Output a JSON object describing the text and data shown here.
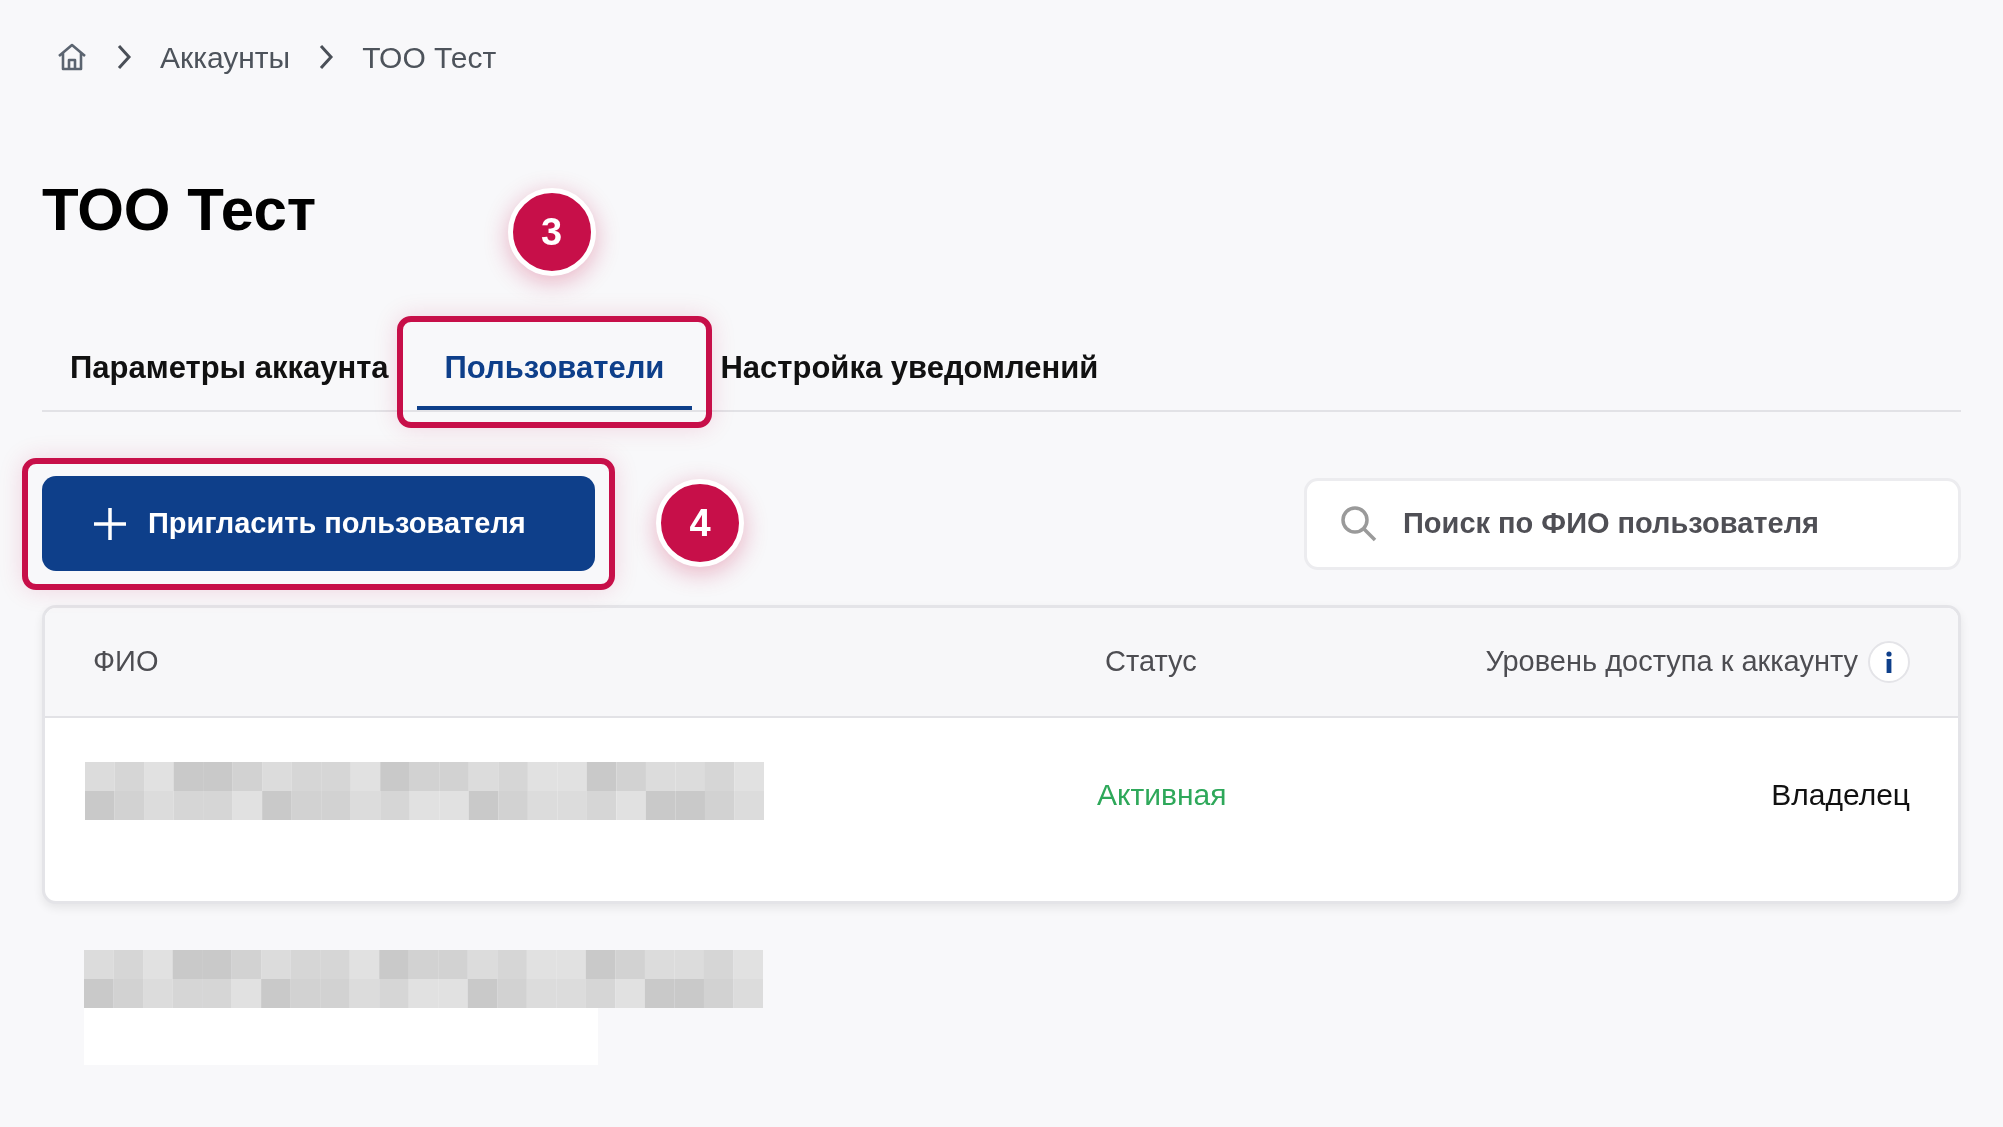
{
  "breadcrumbs": [
    {
      "kind": "home"
    },
    {
      "kind": "link",
      "label": "Аккаунты"
    },
    {
      "kind": "current",
      "label": "ТОО Тест"
    }
  ],
  "title": "ТОО Тест",
  "tabs": [
    {
      "label": "Параметры аккаунта",
      "selected": false
    },
    {
      "label": "Пользователи",
      "selected": true,
      "callout": "3"
    },
    {
      "label": "Настройка уведомлений",
      "selected": false
    }
  ],
  "invite_button": {
    "label": "Пригласить пользователя",
    "callout": "4"
  },
  "search": {
    "placeholder": "Поиск по ФИО пользователя"
  },
  "table": {
    "columns": [
      {
        "label": "ФИО",
        "info": false
      },
      {
        "label": "Статус",
        "info": false
      },
      {
        "label": "Уровень доступа к аккаунту",
        "info": true
      }
    ],
    "rows": [
      {
        "name": {
          "kind": "redacted"
        },
        "status": {
          "label": "Активная",
          "color": "#2ea85a"
        },
        "access": "Владелец"
      }
    ]
  },
  "below_table": [
    {
      "kind": "redacted"
    },
    {
      "kind": "blank"
    }
  ]
}
